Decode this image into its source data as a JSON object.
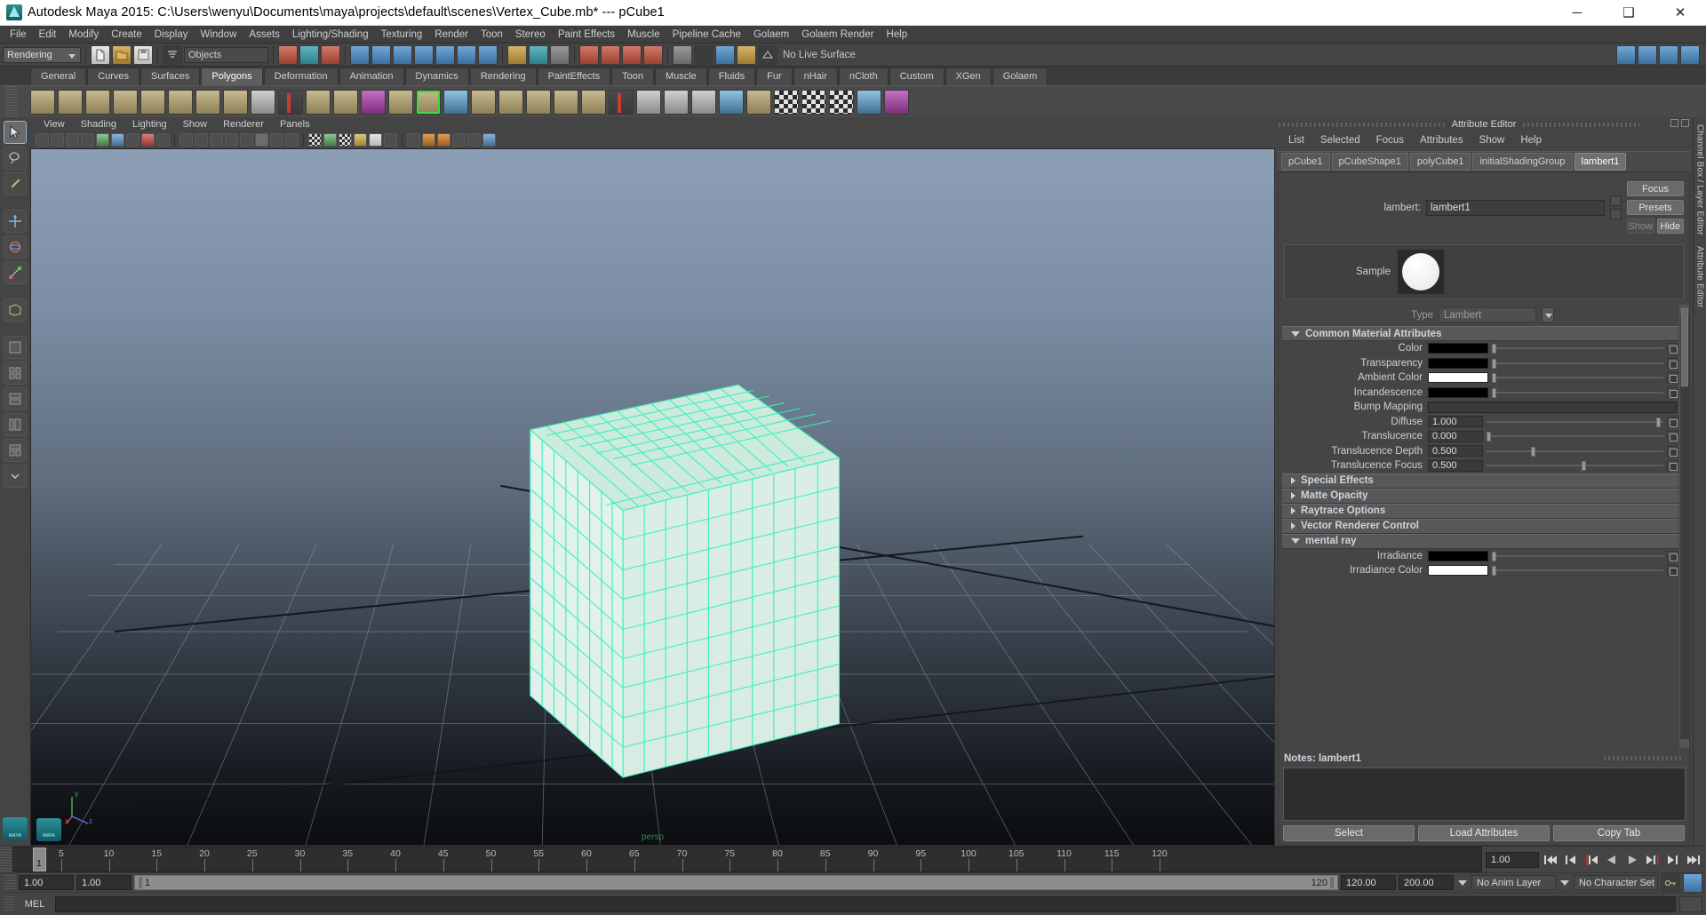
{
  "window": {
    "title": "Autodesk Maya 2015: C:\\Users\\wenyu\\Documents\\maya\\projects\\default\\scenes\\Vertex_Cube.mb*   ---   pCube1",
    "minimize": "─",
    "maximize": "❑",
    "close": "✕"
  },
  "menubar": {
    "items": [
      "File",
      "Edit",
      "Modify",
      "Create",
      "Display",
      "Window",
      "Assets",
      "Lighting/Shading",
      "Texturing",
      "Render",
      "Toon",
      "Stereo",
      "Paint Effects",
      "Muscle",
      "Pipeline Cache",
      "Golaem",
      "Golaem Render",
      "Help"
    ]
  },
  "statusbar": {
    "menu_set": "Rendering",
    "selection_mask": "Objects",
    "no_live_surface": "No Live Surface"
  },
  "shelf": {
    "tabs": [
      "General",
      "Curves",
      "Surfaces",
      "Polygons",
      "Deformation",
      "Animation",
      "Dynamics",
      "Rendering",
      "PaintEffects",
      "Toon",
      "Muscle",
      "Fluids",
      "Fur",
      "nHair",
      "nCloth",
      "Custom",
      "XGen",
      "Golaem"
    ],
    "active_tab": "Polygons"
  },
  "viewport": {
    "menus": [
      "View",
      "Shading",
      "Lighting",
      "Show",
      "Renderer",
      "Panels"
    ],
    "camera_label": "persp",
    "axis": {
      "x": "x",
      "y": "y",
      "z": "z"
    }
  },
  "attribute_editor": {
    "panel_title": "Attribute Editor",
    "menus": [
      "List",
      "Selected",
      "Focus",
      "Attributes",
      "Show",
      "Help"
    ],
    "tabs": [
      "pCube1",
      "pCubeShape1",
      "polyCube1",
      "initialShadingGroup",
      "lambert1"
    ],
    "active_tab": "lambert1",
    "node_type_label": "lambert:",
    "node_name": "lambert1",
    "buttons": {
      "focus": "Focus",
      "presets": "Presets",
      "show": "Show",
      "hide": "Hide"
    },
    "sample_label": "Sample",
    "type_label": "Type",
    "type_value": "Lambert",
    "sections": [
      {
        "name": "Common Material Attributes",
        "open": true
      },
      {
        "name": "Special Effects",
        "open": false
      },
      {
        "name": "Matte Opacity",
        "open": false
      },
      {
        "name": "Raytrace Options",
        "open": false
      },
      {
        "name": "Vector Renderer Control",
        "open": false
      },
      {
        "name": "mental ray",
        "open": true
      }
    ],
    "common_attributes": [
      {
        "label": "Color",
        "kind": "color",
        "color": "#000000"
      },
      {
        "label": "Transparency",
        "kind": "color",
        "color": "#000000"
      },
      {
        "label": "Ambient Color",
        "kind": "color",
        "color": "#ffffff"
      },
      {
        "label": "Incandescence",
        "kind": "color",
        "color": "#000000"
      },
      {
        "label": "Bump Mapping",
        "kind": "field",
        "value": ""
      },
      {
        "label": "Diffuse",
        "kind": "number",
        "value": "1.000",
        "slider": 1.0
      },
      {
        "label": "Translucence",
        "kind": "number",
        "value": "0.000",
        "slider": 0.0
      },
      {
        "label": "Translucence Depth",
        "kind": "number",
        "value": "0.500",
        "slider": 0.26
      },
      {
        "label": "Translucence Focus",
        "kind": "number",
        "value": "0.500",
        "slider": 0.56
      }
    ],
    "mental_ray_attributes": [
      {
        "label": "Irradiance",
        "kind": "color",
        "color": "#000000"
      },
      {
        "label": "Irradiance Color",
        "kind": "color",
        "color": "#ffffff"
      }
    ],
    "notes_label": "Notes: lambert1",
    "notes_value": "",
    "footer_buttons": [
      "Select",
      "Load Attributes",
      "Copy Tab"
    ]
  },
  "dock_strip": {
    "labels": [
      "Channel Box / Layer Editor",
      "Attribute Editor"
    ]
  },
  "timeline": {
    "ticks": [
      5,
      10,
      15,
      20,
      25,
      30,
      35,
      40,
      45,
      50,
      55,
      60,
      65,
      70,
      75,
      80,
      85,
      90,
      95,
      100,
      105,
      110,
      115,
      120
    ],
    "current_frame": "1",
    "current_frame_field": "1.00",
    "range_start": "1.00",
    "range_end": "1.00",
    "playback_start": "1",
    "playback_end": "120",
    "anim_end": "120.00",
    "anim_total": "200.00",
    "anim_layer": "No Anim Layer",
    "character_set": "No Character Set"
  },
  "command_line": {
    "language": "MEL",
    "value": ""
  }
}
